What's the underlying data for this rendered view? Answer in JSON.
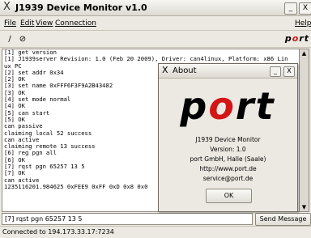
{
  "window": {
    "title": "J1939 Device Monitor v1.0",
    "close_glyph": "X",
    "minimize_glyph": "_",
    "maximize_glyph": "X"
  },
  "menu": {
    "file": "File",
    "edit": "Edit",
    "view": "View",
    "connection": "Connection",
    "help": "Help"
  },
  "toolbar": {
    "icon1": "∕",
    "icon2": "⊘",
    "logo_p": "p",
    "logo_o": "o",
    "logo_rt": "rt"
  },
  "console_lines": [
    "[1] get version",
    "[1] J1939server Revision: 1.0 (Feb 20 2009), Driver: can4linux, Platform: x86 Lin",
    "ux PC",
    "[2] set addr 0x34",
    "[2] OK",
    "[3] set name 0xFFF6F3F9A2B43482",
    "[3] OK",
    "[4] set mode normal",
    "[4] OK",
    "[5] can start",
    "[5] OK",
    "can passive",
    "claiming local 52 success",
    "can active",
    "claiming remote 13 success",
    "[6] reg pgn all",
    "[6] OK",
    "[7] rqst pgn 65257 13 5",
    "[7] OK",
    "can active",
    "1235116201.984625 0xFEE9 0xFF 0xD 0x8 0x0"
  ],
  "command": {
    "value": "[7] rqst pgn 65257 13 5",
    "send_label": "Send Message"
  },
  "status": {
    "text": "Connected to 194.173.33.17:7234"
  },
  "about": {
    "title": "About",
    "close_glyph": "X",
    "minimize_glyph": "_",
    "logo_p": "p",
    "logo_o": "o",
    "logo_rt": "rt",
    "app_name": "J1939 Device Monitor",
    "version": "Version: 1.0",
    "company": "port GmbH, Halle (Saale)",
    "url": "http://www.port.de",
    "email": "service@port.de",
    "ok_label": "OK"
  },
  "colors": {
    "logo_red": "#d21616",
    "background": "#ece9e2"
  }
}
